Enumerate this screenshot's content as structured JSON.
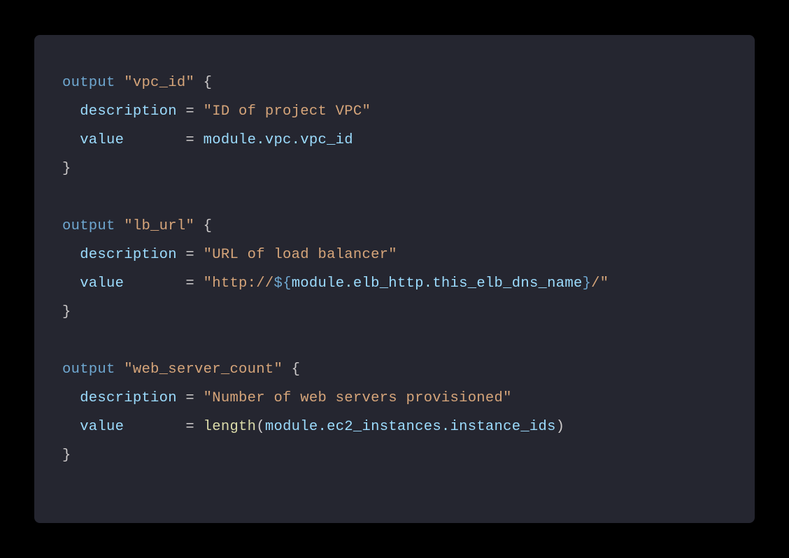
{
  "code": {
    "b1_l1_kw": "output",
    "b1_l1_name": "\"vpc_id\"",
    "b1_l1_brace": " {",
    "b1_l2_prop": "  description",
    "b1_l2_eq": " = ",
    "b1_l2_val": "\"ID of project VPC\"",
    "b1_l3_prop": "  value      ",
    "b1_l3_eq": " = ",
    "b1_l3_val": "module.vpc.vpc_id",
    "b1_l4": "}",
    "b2_l1_kw": "output",
    "b2_l1_name": "\"lb_url\"",
    "b2_l1_brace": " {",
    "b2_l2_prop": "  description",
    "b2_l2_eq": " = ",
    "b2_l2_val": "\"URL of load balancer\"",
    "b2_l3_prop": "  value      ",
    "b2_l3_eq": " = ",
    "b2_l3_q1": "\"http://",
    "b2_l3_interp_open": "${",
    "b2_l3_interp_body": "module.elb_http.this_elb_dns_name",
    "b2_l3_interp_close": "}",
    "b2_l3_q2": "/\"",
    "b2_l4": "}",
    "b3_l1_kw": "output",
    "b3_l1_name": "\"web_server_count\"",
    "b3_l1_brace": " {",
    "b3_l2_prop": "  description",
    "b3_l2_eq": " = ",
    "b3_l2_val": "\"Number of web servers provisioned\"",
    "b3_l3_prop": "  value      ",
    "b3_l3_eq": " = ",
    "b3_l3_func": "length",
    "b3_l3_paren_open": "(",
    "b3_l3_arg": "module.ec2_instances.instance_ids",
    "b3_l3_paren_close": ")",
    "b3_l4": "}"
  }
}
